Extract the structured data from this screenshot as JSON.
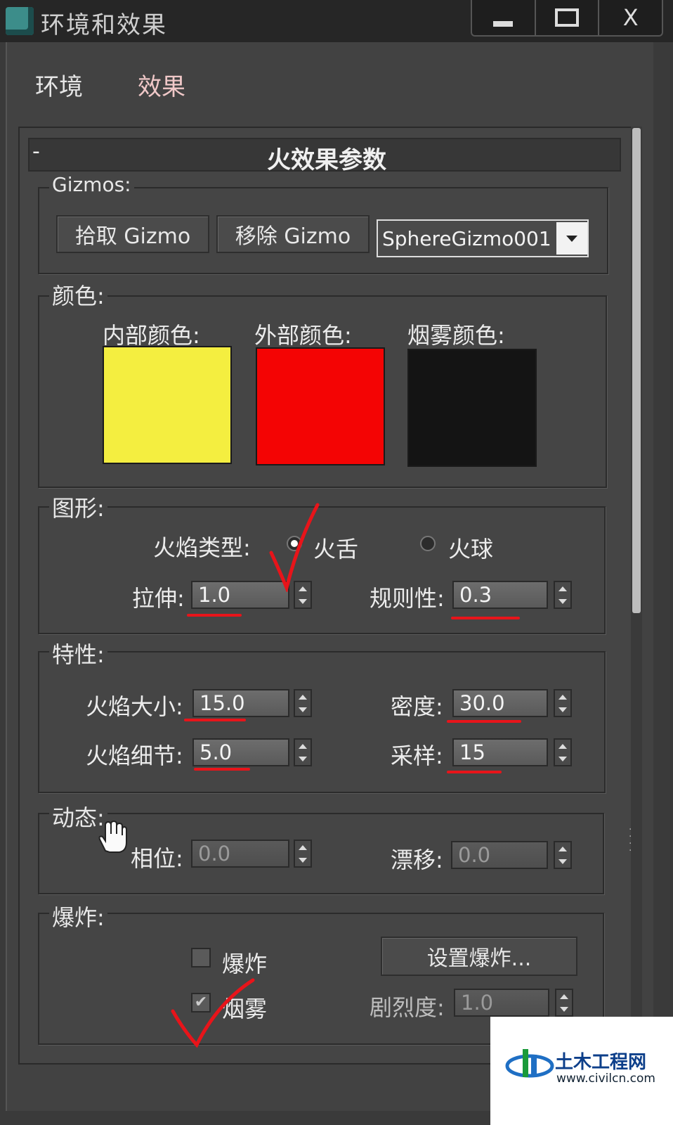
{
  "window": {
    "title": "环境和效果",
    "controls": [
      "minimize",
      "maximize",
      "close"
    ],
    "close_glyph": "X"
  },
  "tabs": [
    {
      "label": "环境"
    },
    {
      "label": "效果"
    }
  ],
  "rollout": {
    "collapse_glyph": "-",
    "title": "火效果参数"
  },
  "gizmos": {
    "label": "Gizmos:",
    "pick_button": "拾取 Gizmo",
    "remove_button": "移除 Gizmo",
    "selected": "SphereGizmo001"
  },
  "colors": {
    "label": "颜色:",
    "inner": {
      "label": "内部颜色:",
      "value": "#f4ee40"
    },
    "outer": {
      "label": "外部颜色:",
      "value": "#f40404"
    },
    "smoke": {
      "label": "烟雾颜色:",
      "value": "#141414"
    }
  },
  "shape": {
    "label": "图形:",
    "flame_type_label": "火焰类型:",
    "options": [
      {
        "label": "火舌",
        "selected": true
      },
      {
        "label": "火球",
        "selected": false
      }
    ],
    "stretch": {
      "label": "拉伸:",
      "value": "1.0"
    },
    "regularity": {
      "label": "规则性:",
      "value": "0.3"
    }
  },
  "characteristics": {
    "label": "特性:",
    "flame_size": {
      "label": "火焰大小:",
      "value": "15.0"
    },
    "density": {
      "label": "密度:",
      "value": "30.0"
    },
    "flame_detail": {
      "label": "火焰细节:",
      "value": "5.0"
    },
    "samples": {
      "label": "采样:",
      "value": "15"
    }
  },
  "motion": {
    "label": "动态:",
    "phase": {
      "label": "相位:",
      "value": "0.0"
    },
    "drift": {
      "label": "漂移:",
      "value": "0.0"
    }
  },
  "explosion": {
    "label": "爆炸:",
    "explode": {
      "label": "爆炸",
      "checked": false
    },
    "smoke": {
      "label": "烟雾",
      "checked": true
    },
    "setup_button": "设置爆炸...",
    "fury": {
      "label": "剧烈度:",
      "value": "1.0"
    }
  },
  "watermark": {
    "name": "土木工程网",
    "url": "www.civilcn.com"
  },
  "annotation_color": "#e8141a"
}
